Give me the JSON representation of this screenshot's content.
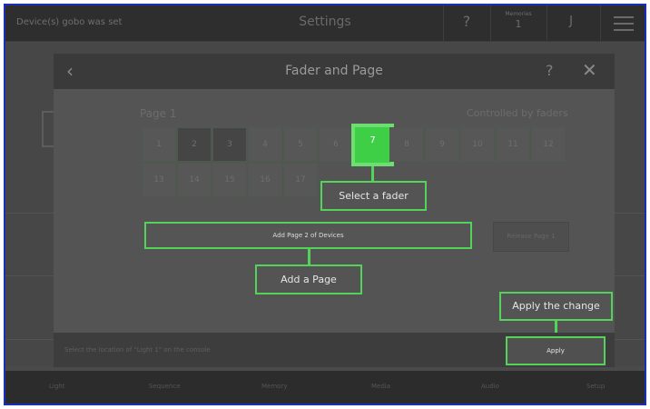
{
  "topbar": {
    "status_message": "Device(s) gobo was set",
    "title": "Settings",
    "help_label": "?",
    "memory_label": "Memories",
    "memory_value": "1",
    "user_label": "J"
  },
  "modal": {
    "title": "Fader and Page",
    "back_icon": "‹",
    "help_label": "?",
    "close_icon": "✕",
    "page_label": "Page 1",
    "controlled_label": "Controlled by faders",
    "faders_row1": [
      "1",
      "2",
      "3",
      "4",
      "5",
      "6",
      "7",
      "8",
      "9",
      "10",
      "11",
      "12"
    ],
    "faders_row2": [
      "13",
      "14",
      "15",
      "16",
      "17"
    ],
    "active_fader": "7",
    "add_page_label": "Add Page 2 of Devices",
    "release_label": "Release Page 1",
    "footer_text": "Select the location of \"Light 1\" on the console",
    "apply_label": "Apply"
  },
  "callouts": {
    "select_fader": "Select a fader",
    "add_page": "Add a Page",
    "apply_change": "Apply the change"
  },
  "tabs": [
    "Light",
    "Sequence",
    "Memory",
    "Media",
    "Audio",
    "Setup"
  ],
  "colors": {
    "accent": "#54d35a",
    "active_fader": "#3fcf47",
    "frame_border": "#1a2fb8"
  }
}
